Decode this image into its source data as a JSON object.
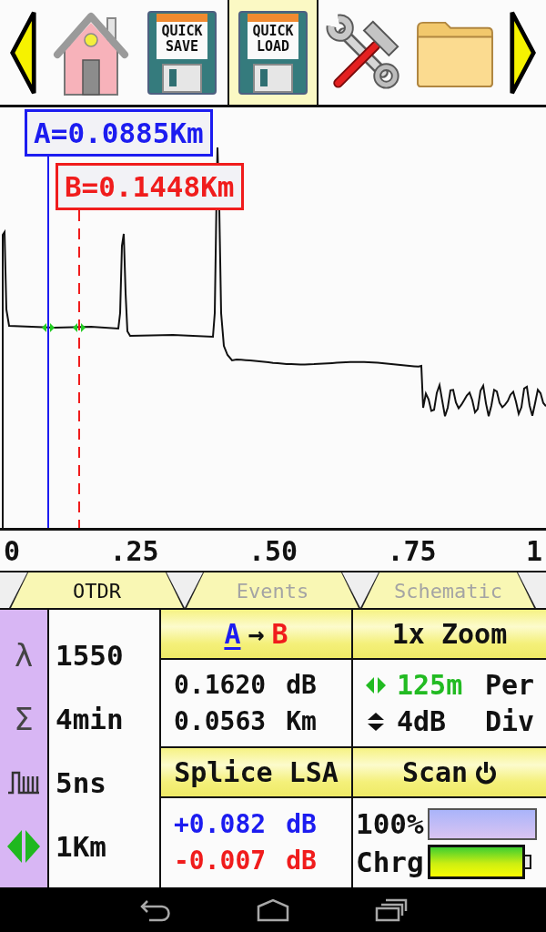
{
  "toolbar": {
    "items": [
      {
        "kind": "home",
        "selected": false
      },
      {
        "kind": "quick-save",
        "label": "QUICK SAVE",
        "selected": false
      },
      {
        "kind": "quick-load",
        "label": "QUICK LOAD",
        "selected": true
      },
      {
        "kind": "tools",
        "selected": false
      },
      {
        "kind": "folder",
        "selected": false
      }
    ]
  },
  "trace": {
    "cursors": [
      {
        "reading": "A=0.0885Km",
        "color": "#1c1cf0",
        "kind": "solid",
        "selected": true
      },
      {
        "reading": "B=0.1448Km",
        "color": "#f01c1c",
        "kind": "dashed",
        "selected": false
      }
    ],
    "axis_labels": [
      "0",
      ".25",
      ".50",
      ".75",
      "1"
    ]
  },
  "tabs": [
    {
      "label": "OTDR",
      "selected": true
    },
    {
      "label": "Events",
      "selected": false
    },
    {
      "label": "Schematic",
      "selected": false
    }
  ],
  "settings": [
    {
      "kind": "glyph",
      "symbol": "λ",
      "value": "1550"
    },
    {
      "kind": "glyph",
      "symbol": "Σ",
      "value": "4min"
    },
    {
      "kind": "pulse",
      "value": "5ns"
    },
    {
      "kind": "range",
      "value": "1Km"
    }
  ],
  "cursor_panel": {
    "from": "A",
    "arrow": "→",
    "to": "B",
    "readings": [
      {
        "value": "0.1620",
        "unit": "dB"
      },
      {
        "value": "0.0563",
        "unit": "Km"
      }
    ]
  },
  "zoom_panel": {
    "title": "1x Zoom",
    "scales": [
      {
        "kind": "horizontal",
        "value": "125m",
        "unit": "Per",
        "selected": true
      },
      {
        "kind": "vertical",
        "value": "4dB",
        "unit": "Div",
        "selected": false
      }
    ]
  },
  "splice_panel": {
    "title": "Splice LSA",
    "readings": [
      {
        "value": "+0.082",
        "unit": "dB",
        "color": "#1c1cf0"
      },
      {
        "value": "-0.007",
        "unit": "dB",
        "color": "#f01c1c"
      }
    ]
  },
  "scan_panel": {
    "title": "Scan",
    "progress": {
      "reading": "100%",
      "level": 1.0
    },
    "battery": {
      "label": "Chrg"
    }
  }
}
